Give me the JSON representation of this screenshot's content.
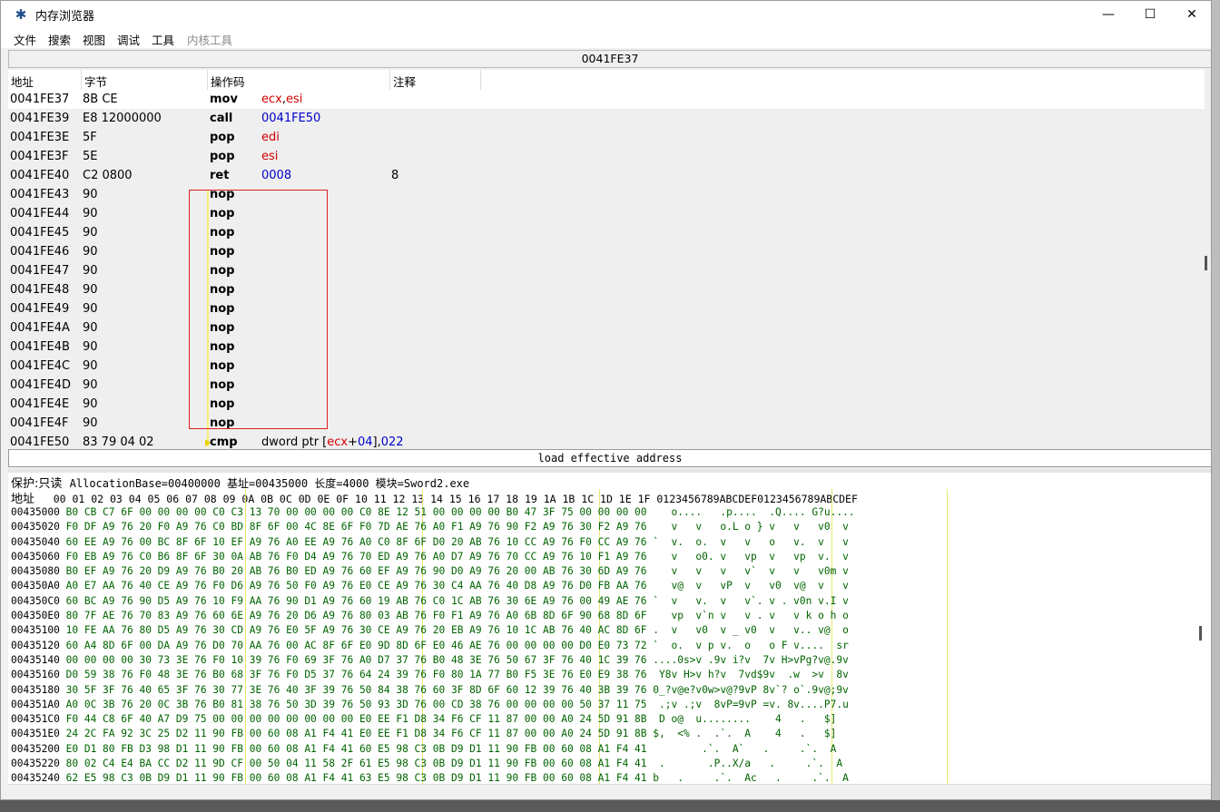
{
  "window": {
    "title": "内存浏览器",
    "controls": {
      "minimize": "—",
      "maximize": "☐",
      "close": "✕"
    }
  },
  "menu": [
    "文件",
    "搜索",
    "视图",
    "调试",
    "工具",
    "内核工具"
  ],
  "address_bar": "0041FE37",
  "disassembler": {
    "headers": {
      "address": "地址",
      "bytes": "字节",
      "opcode": "操作码",
      "comment": "注释"
    },
    "rows": [
      {
        "address": "0041FE37",
        "bytes": "8B CE",
        "op": "mov",
        "args": [
          {
            "t": "ecx",
            "k": "reg"
          },
          {
            "t": ",",
            "k": "plain"
          },
          {
            "t": "esi",
            "k": "reg"
          }
        ],
        "comment": ""
      },
      {
        "address": "0041FE39",
        "bytes": "E8 12000000",
        "op": "call",
        "args": [
          {
            "t": "0041FE50",
            "k": "num"
          }
        ],
        "comment": ""
      },
      {
        "address": "0041FE3E",
        "bytes": "5F",
        "op": "pop",
        "args": [
          {
            "t": "edi",
            "k": "reg"
          }
        ],
        "comment": ""
      },
      {
        "address": "0041FE3F",
        "bytes": "5E",
        "op": "pop",
        "args": [
          {
            "t": "esi",
            "k": "reg"
          }
        ],
        "comment": ""
      },
      {
        "address": "0041FE40",
        "bytes": "C2 0800",
        "op": "ret",
        "args": [
          {
            "t": "0008",
            "k": "num"
          }
        ],
        "comment": "8"
      },
      {
        "address": "0041FE43",
        "bytes": "90",
        "op": "nop",
        "args": [],
        "comment": ""
      },
      {
        "address": "0041FE44",
        "bytes": "90",
        "op": "nop",
        "args": [],
        "comment": ""
      },
      {
        "address": "0041FE45",
        "bytes": "90",
        "op": "nop",
        "args": [],
        "comment": ""
      },
      {
        "address": "0041FE46",
        "bytes": "90",
        "op": "nop",
        "args": [],
        "comment": ""
      },
      {
        "address": "0041FE47",
        "bytes": "90",
        "op": "nop",
        "args": [],
        "comment": ""
      },
      {
        "address": "0041FE48",
        "bytes": "90",
        "op": "nop",
        "args": [],
        "comment": ""
      },
      {
        "address": "0041FE49",
        "bytes": "90",
        "op": "nop",
        "args": [],
        "comment": ""
      },
      {
        "address": "0041FE4A",
        "bytes": "90",
        "op": "nop",
        "args": [],
        "comment": ""
      },
      {
        "address": "0041FE4B",
        "bytes": "90",
        "op": "nop",
        "args": [],
        "comment": ""
      },
      {
        "address": "0041FE4C",
        "bytes": "90",
        "op": "nop",
        "args": [],
        "comment": ""
      },
      {
        "address": "0041FE4D",
        "bytes": "90",
        "op": "nop",
        "args": [],
        "comment": ""
      },
      {
        "address": "0041FE4E",
        "bytes": "90",
        "op": "nop",
        "args": [],
        "comment": ""
      },
      {
        "address": "0041FE4F",
        "bytes": "90",
        "op": "nop",
        "args": [],
        "comment": ""
      },
      {
        "address": "0041FE50",
        "bytes": "83 79 04 02",
        "op": "cmp",
        "args": [
          {
            "t": "dword ptr [",
            "k": "plain"
          },
          {
            "t": "ecx",
            "k": "reg"
          },
          {
            "t": "+",
            "k": "plain"
          },
          {
            "t": "04",
            "k": "num"
          },
          {
            "t": "],",
            "k": "plain"
          },
          {
            "t": "022",
            "k": "num"
          }
        ],
        "comment": ""
      }
    ]
  },
  "instruction_description": "load effective address",
  "hex_view": {
    "protection": "保护:只读",
    "info": "AllocationBase=00400000 基址=00435000 长度=4000 模块=Sword2.exe",
    "header_label": "地址",
    "header_columns": "00 01 02 03 04 05 06 07 08 09 0A 0B 0C 0D 0E 0F 10 11 12 13 14 15 16 17 18 19 1A 1B 1C 1D 1E 1F 0123456789ABCDEF0123456789ABCDEF",
    "rows": [
      {
        "address": "00435000",
        "bytes": "B0 CB C7 6F 00 00 00 00 C0 C3 13 70 00 00 00 00 C0 8E 12 51 00 00 00 00 B0 47 3F 75 00 00 00 00",
        "ascii": "   o....   .p....  .Q.... G?u...."
      },
      {
        "address": "00435020",
        "bytes": "F0 DF A9 76 20 F0 A9 76 C0 BD 8F 6F 00 4C 8E 6F F0 7D AE 76 A0 F1 A9 76 90 F2 A9 76 30 F2 A9 76",
        "ascii": "   v   v   o.L o } v   v   v0  v"
      },
      {
        "address": "00435040",
        "bytes": "60 EE A9 76 00 BC 8F 6F 10 EF A9 76 A0 EE A9 76 A0 C0 8F 6F D0 20 AB 76 10 CC A9 76 F0 CC A9 76",
        "ascii": "`  v.  o.  v   v   o   v.  v   v"
      },
      {
        "address": "00435060",
        "bytes": "F0 EB A9 76 C0 B6 8F 6F 30 0A AB 76 F0 D4 A9 76 70 ED A9 76 A0 D7 A9 76 70 CC A9 76 10 F1 A9 76",
        "ascii": "   v   o0. v   vp  v   vp  v.  v"
      },
      {
        "address": "00435080",
        "bytes": "B0 EF A9 76 20 D9 A9 76 B0 20 AB 76 B0 ED A9 76 60 EF A9 76 90 D0 A9 76 20 00 AB 76 30 6D A9 76",
        "ascii": "   v   v   v   v`  v   v   v0m v"
      },
      {
        "address": "004350A0",
        "bytes": "A0 E7 AA 76 40 CE A9 76 F0 D6 A9 76 50 F0 A9 76 E0 CE A9 76 30 C4 AA 76 40 D8 A9 76 D0 FB AA 76",
        "ascii": "   v@  v   vP  v   v0  v@  v   v"
      },
      {
        "address": "004350C0",
        "bytes": "60 BC A9 76 90 D5 A9 76 10 F9 AA 76 90 D1 A9 76 60 19 AB 76 C0 1C AB 76 30 6E A9 76 00 49 AE 76",
        "ascii": "`  v   v.  v   v`. v . v0n v.I v"
      },
      {
        "address": "004350E0",
        "bytes": "80 7F AE 76 70 83 A9 76 60 6E A9 76 20 D6 A9 76 80 03 AB 76 F0 F1 A9 76 A0 6B 8D 6F 90 68 8D 6F",
        "ascii": "   vp  v`n v   v . v   v k o h o"
      },
      {
        "address": "00435100",
        "bytes": "10 FE AA 76 80 D5 A9 76 30 CD A9 76 E0 5F A9 76 30 CE A9 76 20 EB A9 76 10 1C AB 76 40 AC 8D 6F",
        "ascii": ".  v   v0  v _ v0  v   v.. v@  o"
      },
      {
        "address": "00435120",
        "bytes": "60 A4 8D 6F 00 DA A9 76 D0 70 AA 76 00 AC 8F 6F E0 9D 8D 6F E0 46 AE 76 00 00 00 00 D0 E0 73 72",
        "ascii": "`  o.  v p v.  o   o F v....  sr"
      },
      {
        "address": "00435140",
        "bytes": "00 00 00 00 30 73 3E 76 F0 10 39 76 F0 69 3F 76 A0 D7 37 76 B0 48 3E 76 50 67 3F 76 40 1C 39 76",
        "ascii": "....0s>v .9v i?v  7v H>vPg?v@.9v"
      },
      {
        "address": "00435160",
        "bytes": "D0 59 38 76 F0 48 3E 76 B0 68 3F 76 F0 D5 37 76 64 24 39 76 F0 80 1A 77 B0 F5 3E 76 E0 E9 38 76",
        "ascii": " Y8v H>v h?v  7vd$9v  .w  >v  8v"
      },
      {
        "address": "00435180",
        "bytes": "30 5F 3F 76 40 65 3F 76 30 77 3E 76 40 3F 39 76 50 84 38 76 60 3F 8D 6F 60 12 39 76 40 3B 39 76",
        "ascii": "0_?v@e?v0w>v@?9vP 8v`? o`.9v@;9v"
      },
      {
        "address": "004351A0",
        "bytes": "A0 0C 3B 76 20 0C 3B 76 B0 81 38 76 50 3D 39 76 50 93 3D 76 00 CD 38 76 00 00 00 00 50 37 11 75",
        "ascii": " .;v .;v  8vP=9vP =v. 8v....P7.u"
      },
      {
        "address": "004351C0",
        "bytes": "F0 44 C8 6F 40 A7 D9 75 00 00 00 00 00 00 00 00 E0 EE F1 D8 34 F6 CF 11 87 00 00 A0 24 5D 91 8B",
        "ascii": " D o@  u........    4   .   $]  "
      },
      {
        "address": "004351E0",
        "bytes": "24 2C FA 92 3C 25 D2 11 90 FB 00 60 08 A1 F4 41 E0 EE F1 D8 34 F6 CF 11 87 00 00 A0 24 5D 91 8B",
        "ascii": "$,  <% .  .`.  A    4   .   $]  "
      },
      {
        "address": "00435200",
        "bytes": "E0 D1 80 FB D3 98 D1 11 90 FB 00 60 08 A1 F4 41 60 E5 98 C3 0B D9 D1 11 90 FB 00 60 08 A1 F4 41",
        "ascii": "        .`.  A`   .     .`.  A"
      },
      {
        "address": "00435220",
        "bytes": "80 02 C4 E4 BA CC D2 11 9D CF 00 50 04 11 58 2F 61 E5 98 C3 0B D9 D1 11 90 FB 00 60 08 A1 F4 41",
        "ascii": " .       .P..X/a   .     .`.  A"
      },
      {
        "address": "00435240",
        "bytes": "62 E5 98 C3 0B D9 D1 11 90 FB 00 60 08 A1 F4 41 63 E5 98 C3 0B D9 D1 11 90 FB 00 60 08 A1 F4 41",
        "ascii": "b   .     .`.  Ac   .     .`.  A"
      }
    ]
  }
}
